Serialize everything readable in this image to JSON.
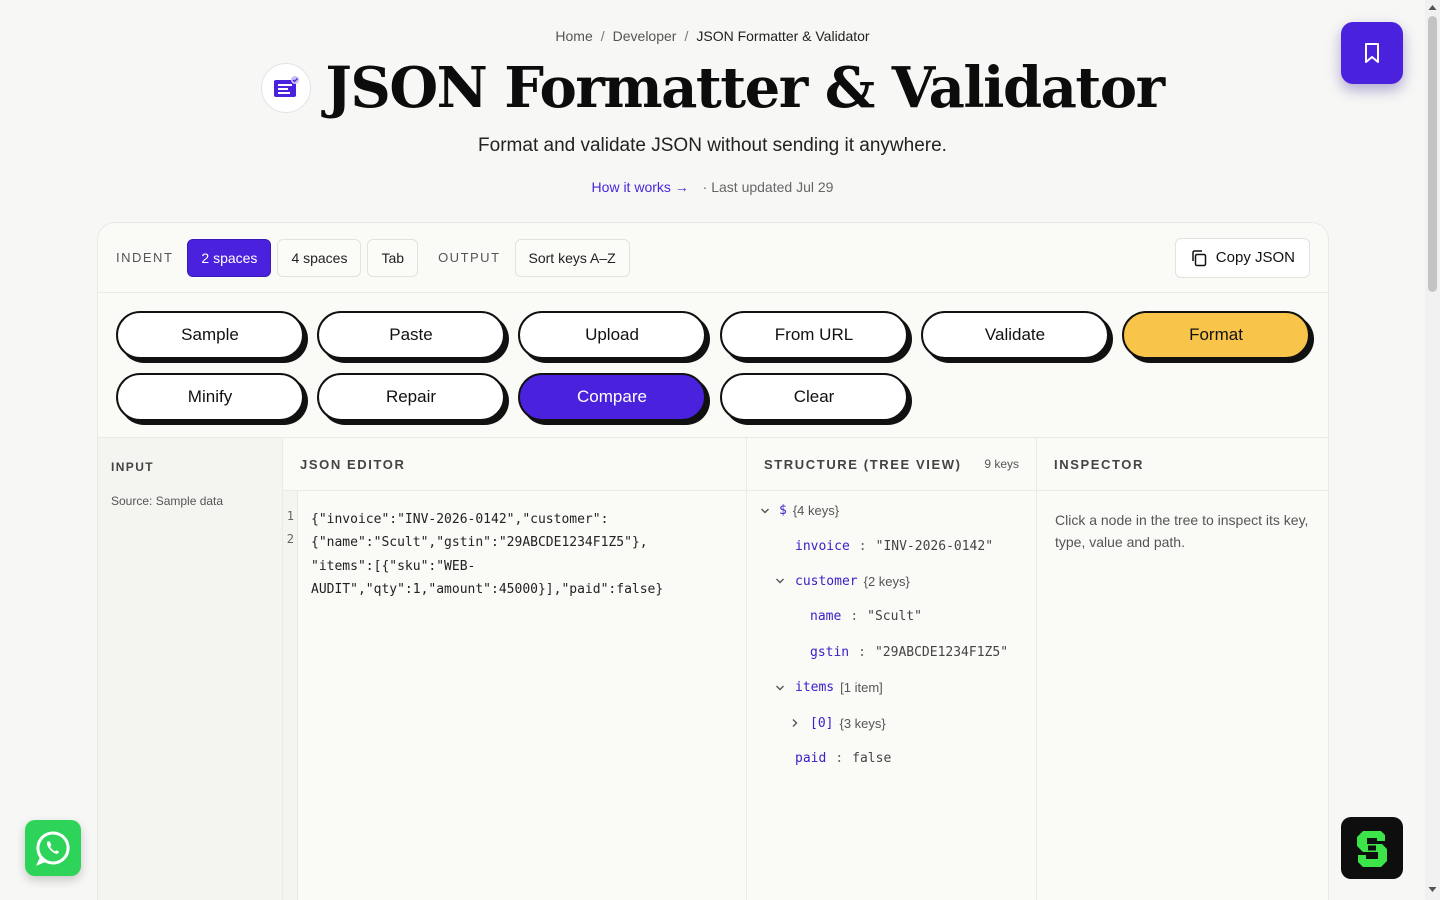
{
  "breadcrumb": {
    "home": "Home",
    "developer": "Developer",
    "current": "JSON Formatter & Validator",
    "separator": "/"
  },
  "header": {
    "title": "JSON Formatter & Validator",
    "subtitle": "Format and validate JSON without sending it anywhere.",
    "how_it_works": "How it works →",
    "last_updated": "· Last updated Jul 29"
  },
  "toolbar": {
    "indent_label": "INDENT",
    "indent_options": [
      "2 spaces",
      "4 spaces",
      "Tab"
    ],
    "indent_selected": "2 spaces",
    "output_label": "OUTPUT",
    "sort_keys": "Sort keys A–Z",
    "copy_json": "Copy JSON"
  },
  "actions": {
    "sample": "Sample",
    "paste": "Paste",
    "upload": "Upload",
    "from_url": "From URL",
    "validate": "Validate",
    "format": "Format",
    "minify": "Minify",
    "repair": "Repair",
    "compare": "Compare",
    "clear": "Clear"
  },
  "input_pane": {
    "label": "INPUT",
    "source": "Source: Sample data"
  },
  "editor": {
    "label": "JSON EDITOR",
    "line_numbers": [
      "1",
      "2"
    ],
    "lines": [
      "{\"invoice\":\"INV-2026-0142\",\"customer\":",
      "{\"name\":\"Scult\",\"gstin\":\"29ABCDE1234F1Z5\"},",
      "\"items\":[{\"sku\":\"WEB-",
      "AUDIT\",\"qty\":1,\"amount\":45000}],\"paid\":false}"
    ]
  },
  "tree": {
    "label": "STRUCTURE (TREE VIEW)",
    "key_count": "9 keys",
    "root": {
      "key": "$",
      "meta": "{4 keys}"
    },
    "invoice": {
      "key": "invoice",
      "value": "\"INV-2026-0142\""
    },
    "customer": {
      "key": "customer",
      "meta": "{2 keys}"
    },
    "name": {
      "key": "name",
      "value": "\"Scult\""
    },
    "gstin": {
      "key": "gstin",
      "value": "\"29ABCDE1234F1Z5\""
    },
    "items": {
      "key": "items",
      "meta": "[1 item]"
    },
    "item0": {
      "key": "[0]",
      "meta": "{3 keys}"
    },
    "paid": {
      "key": "paid",
      "value": "false"
    },
    "colon": ":"
  },
  "inspector": {
    "label": "INSPECTOR",
    "hint": "Click a node in the tree to inspect its key, type, value and path."
  },
  "icons": {
    "logo": "json-logo-icon",
    "bookmark": "bookmark-icon",
    "copy": "copy-icon",
    "whatsapp": "whatsapp-icon",
    "brand": "brand-s-icon",
    "expanded": "chevron-down-icon",
    "collapsed": "chevron-right-icon"
  },
  "colors": {
    "accent": "#4a22de",
    "format_button": "#f8c54a",
    "whatsapp": "#2ed35a",
    "tree_key": "#3c20c9"
  }
}
